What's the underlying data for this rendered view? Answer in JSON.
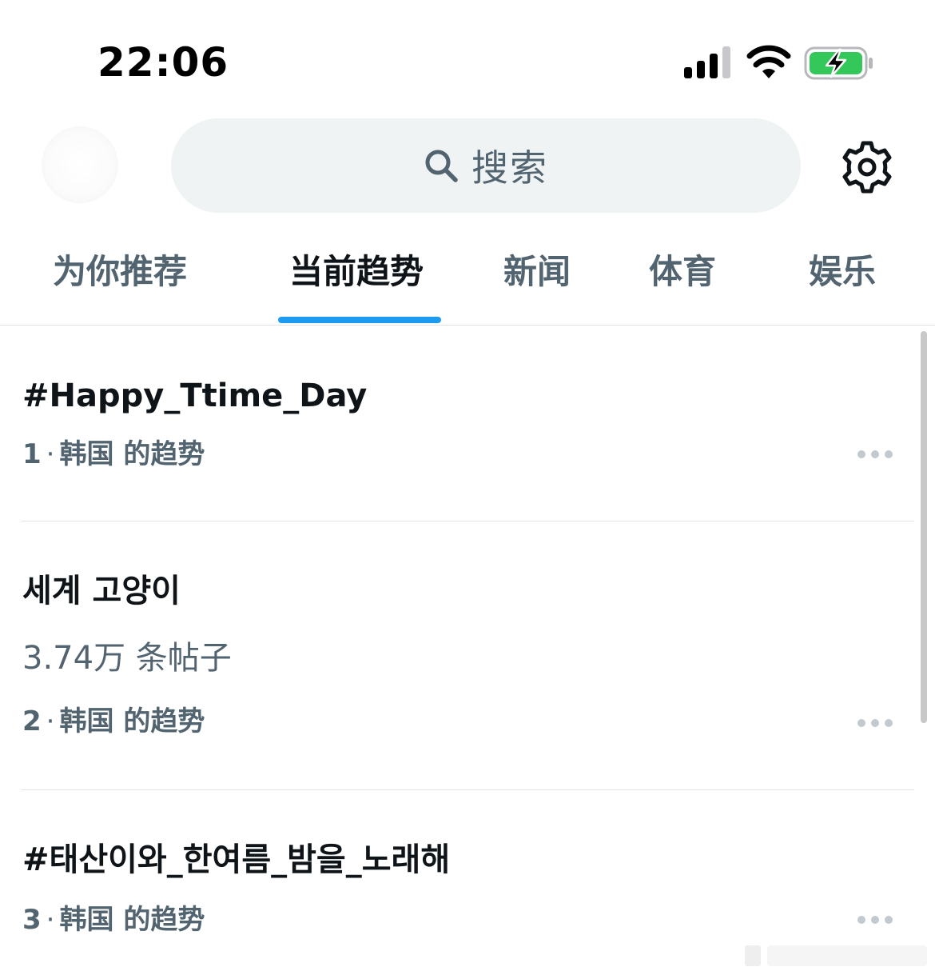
{
  "status_bar": {
    "time": "22:06",
    "signal_icon": "cellular-signal-icon",
    "wifi_icon": "wifi-icon",
    "battery_icon": "battery-charging-icon",
    "battery_color": "#34c759"
  },
  "header": {
    "avatar_icon": "profile-avatar",
    "search_placeholder": "搜索",
    "search_icon": "search-icon",
    "settings_icon": "gear-icon"
  },
  "tabs": [
    {
      "label": "为你推荐",
      "active": false
    },
    {
      "label": "当前趋势",
      "active": true
    },
    {
      "label": "新闻",
      "active": false
    },
    {
      "label": "体育",
      "active": false
    },
    {
      "label": "娱乐",
      "active": false
    }
  ],
  "accent_color": "#1d9bf0",
  "trends": [
    {
      "title": "#Happy_Ttime_Day",
      "rank": "1",
      "location": "韩国 的趋势",
      "more_icon": "more-horizontal-icon"
    },
    {
      "title": "세계 고양이",
      "post_count": "3.74万 条帖子",
      "rank": "2",
      "location": "韩国 的趋势",
      "more_icon": "more-horizontal-icon"
    },
    {
      "title": "#태산이와_한여름_밤을_노래해",
      "rank": "3",
      "location": "韩国 的趋势",
      "more_icon": "more-horizontal-icon"
    }
  ]
}
